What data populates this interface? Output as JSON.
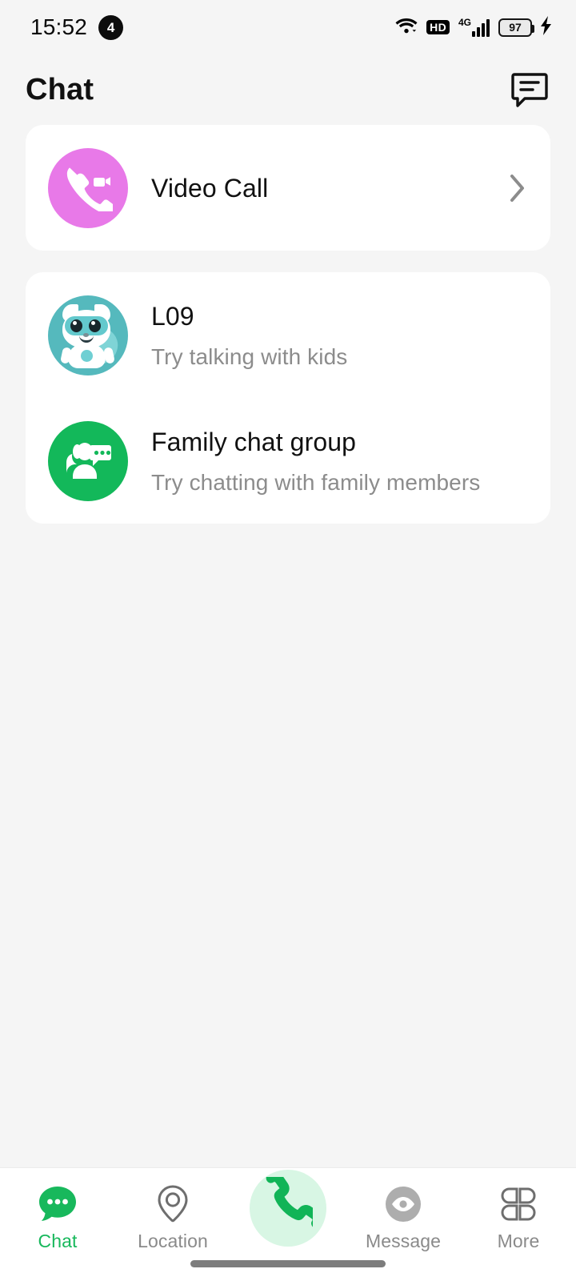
{
  "status_bar": {
    "time": "15:52",
    "notification_count": "4",
    "hd_label": "HD",
    "network_label": "4G",
    "battery_level": "97",
    "icons": [
      "wifi-icon",
      "hd-icon",
      "signal-icon",
      "battery-icon",
      "charging-bolt-icon"
    ]
  },
  "header": {
    "title": "Chat",
    "action_icon": "message-bubble-icon"
  },
  "shortcut_card": {
    "items": [
      {
        "label": "Video Call",
        "icon": "video-call-icon",
        "icon_color": "#e879e8",
        "chevron": "chevron-right-icon"
      }
    ]
  },
  "contacts_card": {
    "items": [
      {
        "title": "L09",
        "subtitle": "Try talking with kids",
        "avatar": "robot-cat-avatar",
        "avatar_color": "#55b9bd"
      },
      {
        "title": "Family chat group",
        "subtitle": "Try chatting with family members",
        "avatar": "group-chat-icon",
        "avatar_color": "#13b85a"
      }
    ]
  },
  "tabbar": {
    "active_color": "#18b85c",
    "inactive_color": "#8a8a8a",
    "items": [
      {
        "label": "Chat",
        "icon": "chat-bubble-icon",
        "active": true
      },
      {
        "label": "Location",
        "icon": "location-pin-icon",
        "active": false
      },
      {
        "label": "",
        "icon": "phone-call-icon",
        "active": false
      },
      {
        "label": "Message",
        "icon": "eye-circle-icon",
        "active": false
      },
      {
        "label": "More",
        "icon": "grid-clover-icon",
        "active": false
      }
    ]
  }
}
